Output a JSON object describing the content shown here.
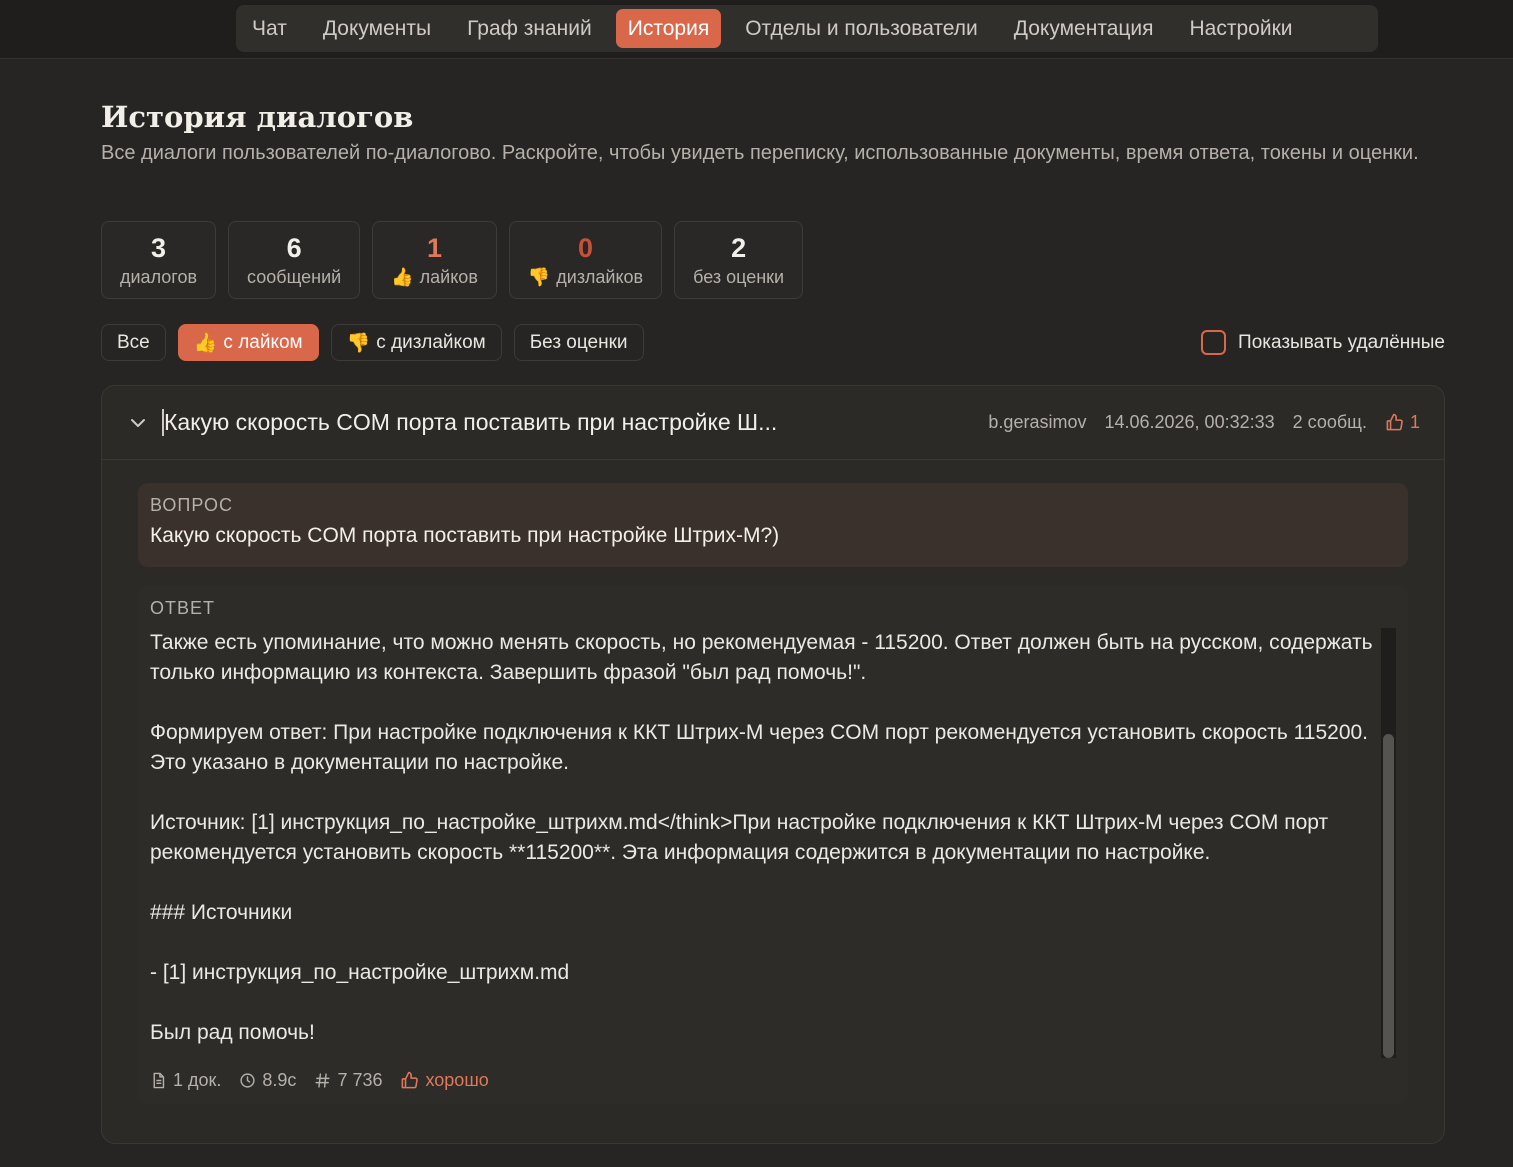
{
  "nav": {
    "items": [
      {
        "label": "Чат",
        "active": false
      },
      {
        "label": "Документы",
        "active": false
      },
      {
        "label": "Граф знаний",
        "active": false
      },
      {
        "label": "История",
        "active": true
      },
      {
        "label": "Отделы и пользователи",
        "active": false
      },
      {
        "label": "Документация",
        "active": false
      },
      {
        "label": "Настройки",
        "active": false
      }
    ]
  },
  "page": {
    "title": "История диалогов",
    "subtitle": "Все диалоги пользователей по-диалогово. Раскройте, чтобы увидеть переписку, использованные документы, время ответа, токены и оценки."
  },
  "stats": [
    {
      "value": "3",
      "label": "диалогов",
      "icon": ""
    },
    {
      "value": "6",
      "label": "сообщений",
      "icon": ""
    },
    {
      "value": "1",
      "label": "лайков",
      "icon": "thumbs-up-emoji"
    },
    {
      "value": "0",
      "label": "дизлайков",
      "icon": "thumbs-down-emoji"
    },
    {
      "value": "2",
      "label": "без оценки",
      "icon": ""
    }
  ],
  "filters": [
    {
      "label": "Все",
      "icon": "",
      "active": false
    },
    {
      "label": "с лайком",
      "icon": "thumbs-up-emoji",
      "active": true
    },
    {
      "label": "с дизлайком",
      "icon": "thumbs-down-emoji",
      "active": false
    },
    {
      "label": "Без оценки",
      "icon": "",
      "active": false
    }
  ],
  "show_deleted": {
    "label": "Показывать удалённые",
    "checked": false
  },
  "dialog": {
    "title": "Какую скорость COM порта поставить при настройке Ш...",
    "user": "b.gerasimov",
    "datetime": "14.06.2026, 00:32:33",
    "messages": "2 сообщ.",
    "likes": "1",
    "question_label": "ВОПРОС",
    "question": "Какую скорость COM порта поставить при настройке Штрих-М?)",
    "answer_label": "ОТВЕТ",
    "answer": "Также есть упоминание, что можно менять скорость, но рекомендуемая - 115200. Ответ должен быть на русском, содержать только информацию из контекста. Завершить фразой \"был рад помочь!\".\n\nФормируем ответ: При настройке подключения к ККТ Штрих-М через COM порт рекомендуется установить скорость 115200. Это указано в документации по настройке.\n\nИсточник: [1] инструкция_по_настройке_штрихм.md</think>При настройке подключения к ККТ Штрих-М через COM порт рекомендуется установить скорость **115200**. Эта информация содержится в документации по настройке.\n\n### Источники\n\n- [1] инструкция_по_настройке_штрихм.md\n\nБыл рад помочь!",
    "footer": {
      "docs": "1 док.",
      "time": "8.9с",
      "tokens": "7 736",
      "rating": "хорошо"
    }
  },
  "colors": {
    "accent": "#d9684a",
    "background": "#262523",
    "like": "#e0785a",
    "dislike": "#c8503a"
  }
}
